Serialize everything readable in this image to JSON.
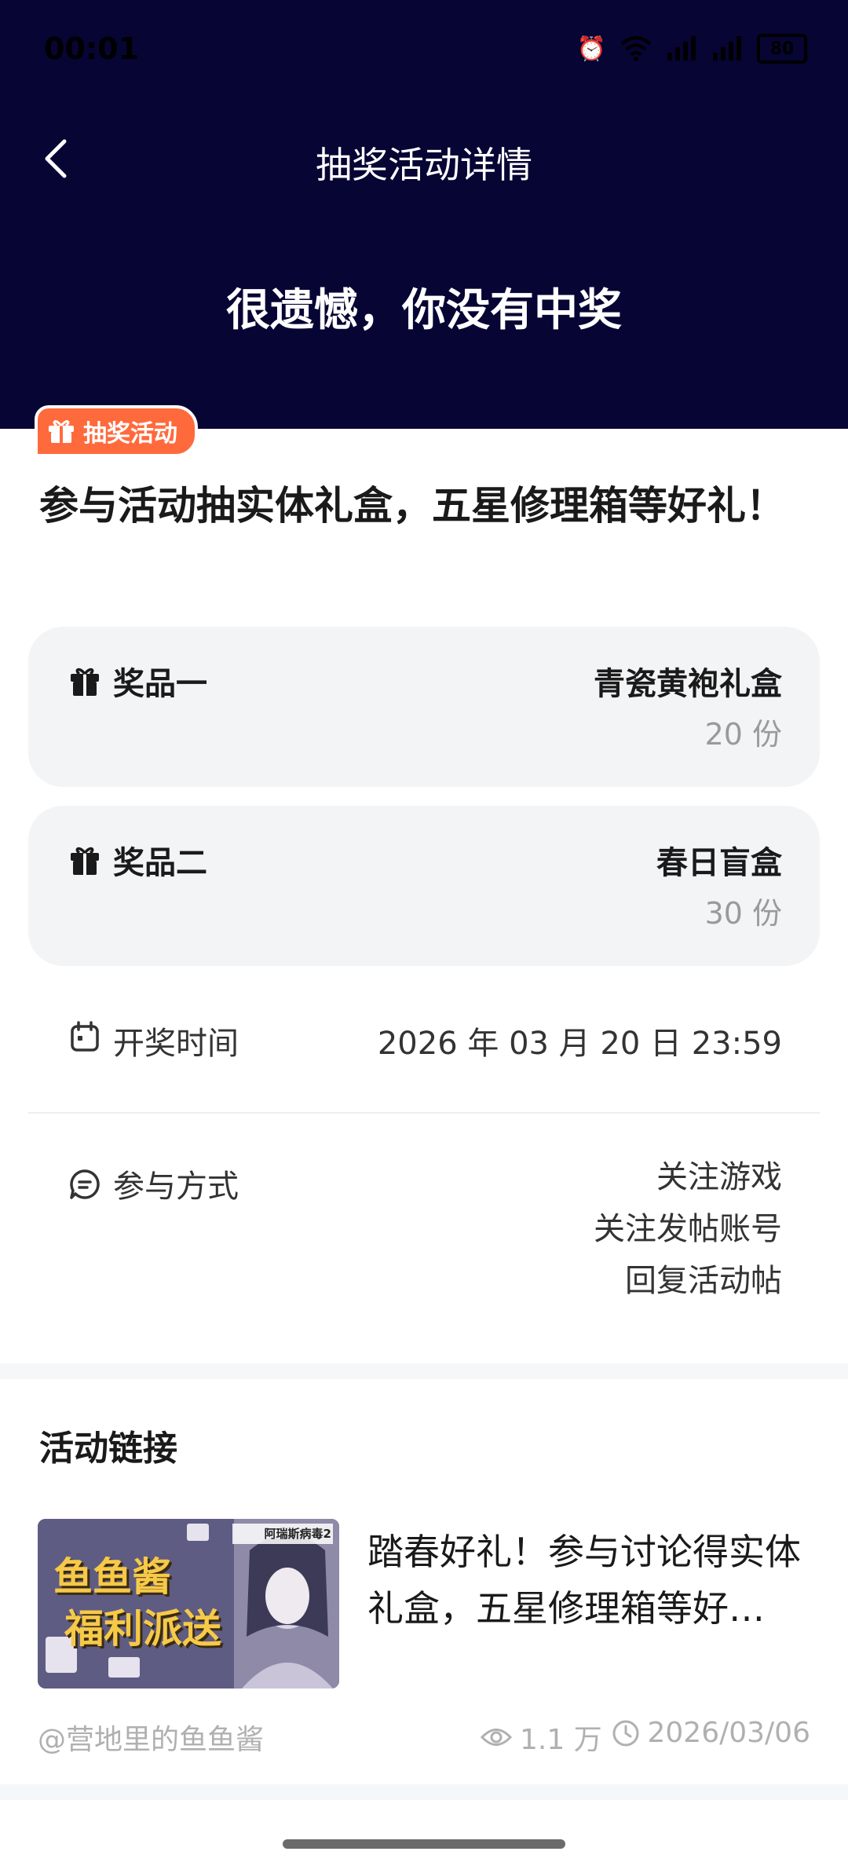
{
  "status_bar": {
    "time": "00:01",
    "battery": "80"
  },
  "header": {
    "title": "抽奖活动详情",
    "result": "很遗憾，你没有中奖"
  },
  "card": {
    "tag": "抽奖活动",
    "title": "参与活动抽实体礼盒，五星修理箱等好礼！"
  },
  "prizes": [
    {
      "label": "奖品一",
      "name": "青瓷黄袍礼盒",
      "quantity": "20 份"
    },
    {
      "label": "奖品二",
      "name": "春日盲盒",
      "quantity": "30 份"
    }
  ],
  "draw_time": {
    "label": "开奖时间",
    "value": "2026 年 03 月 20 日 23:59"
  },
  "participation": {
    "label": "参与方式",
    "methods": [
      "关注游戏",
      "关注发帖账号",
      "回复活动帖"
    ]
  },
  "activity_link": {
    "section_title": "活动链接",
    "post_title": "踏春好礼！参与讨论得实体礼盒，五星修理箱等好…",
    "thumbnail_text_line1": "鱼鱼酱",
    "thumbnail_text_line2": "福利派送",
    "thumbnail_badge": "阿瑞斯病毒2",
    "author": "@营地里的鱼鱼酱",
    "views": "1.1 万",
    "date": "2026/03/06"
  },
  "colors": {
    "header_bg": "#070534",
    "tag_orange": "#ff6a3d",
    "card_bg": "#f3f4f6"
  }
}
